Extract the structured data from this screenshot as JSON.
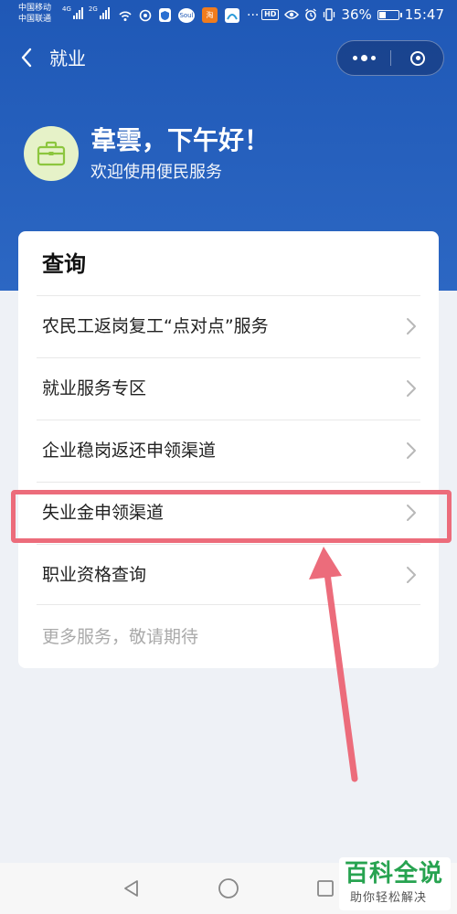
{
  "status_bar": {
    "carrier_1": "中国移动",
    "carrier_2": "中国联通",
    "network_1": "4G",
    "network_2": "2G",
    "battery_percent": "36%",
    "battery_level": 0.36,
    "time": "15:47",
    "hd_label": "HD",
    "soul_label": "Soul",
    "taobao_label": "淘"
  },
  "nav": {
    "title": "就业"
  },
  "greeting": {
    "title": "韋雲，下午好！",
    "subtitle": "欢迎使用便民服务"
  },
  "query_card": {
    "title": "查询",
    "items": [
      {
        "label": "农民工返岗复工“点对点”服务"
      },
      {
        "label": "就业服务专区"
      },
      {
        "label": "企业稳岗返还申领渠道"
      },
      {
        "label": "失业金申领渠道"
      },
      {
        "label": "职业资格查询"
      }
    ],
    "footer_note": "更多服务，敬请期待"
  },
  "annotation": {
    "highlighted_item": "失业金申领渠道",
    "color": "#ec6c7b"
  },
  "watermark": {
    "main": "百科全说",
    "sub": "助你轻松解决"
  },
  "colors": {
    "header_blue": "#1f58b6",
    "avatar_bg": "#e6f2c8",
    "avatar_icon": "#8cc63e",
    "watermark_green": "#27a350"
  },
  "icons": {
    "back": "chevron-left-icon",
    "more": "more-dots-icon",
    "close": "target-close-icon",
    "avatar": "briefcase-icon",
    "row_arrow": "chevron-right-icon",
    "sys_back": "triangle-back-icon",
    "sys_home": "circle-home-icon",
    "sys_recent": "square-recent-icon"
  }
}
